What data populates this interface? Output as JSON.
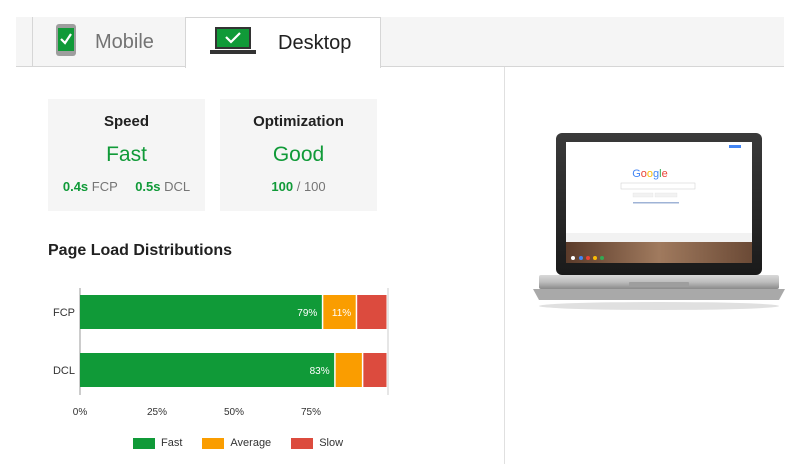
{
  "tabs": [
    {
      "label": "Mobile",
      "active": false
    },
    {
      "label": "Desktop",
      "active": true
    }
  ],
  "cards": {
    "speed": {
      "title": "Speed",
      "value": "Fast",
      "metric1_value": "0.4s",
      "metric1_label": "FCP",
      "metric2_value": "0.5s",
      "metric2_label": "DCL"
    },
    "optimization": {
      "title": "Optimization",
      "value": "Good",
      "score": "100",
      "separator": "/",
      "max": "100"
    }
  },
  "section_title": "Page Load Distributions",
  "colors": {
    "fast": "#109a38",
    "average": "#fa9d00",
    "slow": "#dc4b3e"
  },
  "chart_data": {
    "type": "bar",
    "orientation": "horizontal",
    "stacked": true,
    "categories": [
      "FCP",
      "DCL"
    ],
    "series": [
      {
        "name": "Fast",
        "values": [
          79,
          83
        ],
        "labels": [
          "79%",
          "83%"
        ]
      },
      {
        "name": "Average",
        "values": [
          11,
          9
        ],
        "labels": [
          "11%",
          ""
        ]
      },
      {
        "name": "Slow",
        "values": [
          10,
          8
        ],
        "labels": [
          "",
          ""
        ]
      }
    ],
    "xlim": [
      0,
      100
    ],
    "xticks": [
      0,
      25,
      50,
      75
    ],
    "xtick_labels": [
      "0%",
      "25%",
      "50%",
      "75%"
    ],
    "legend": "bottom"
  },
  "laptop_screen": {
    "logo": "Google",
    "search_button": "Google Search",
    "lucky_button": "I'm Feeling Lucky"
  }
}
